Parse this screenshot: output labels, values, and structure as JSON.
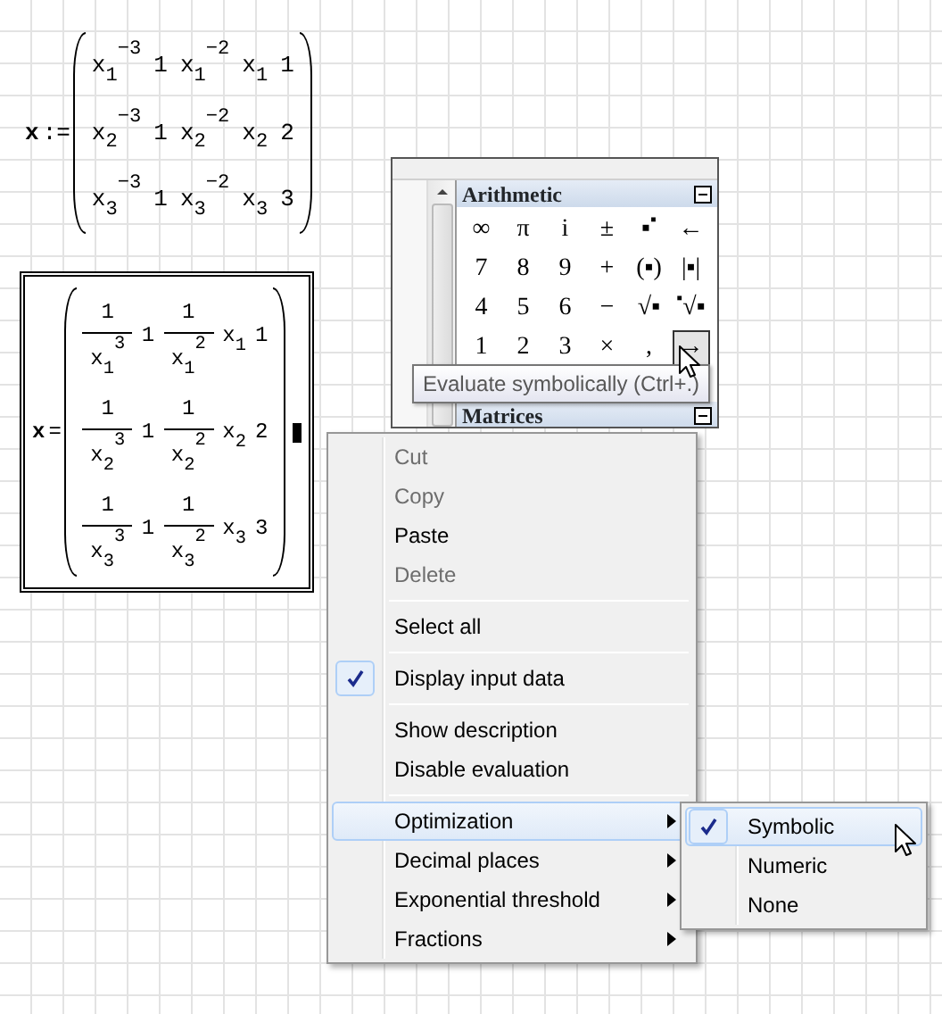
{
  "definition": {
    "variable": "x",
    "operator": ":=",
    "matrix": [
      [
        "x$_{1}$$^{−3}$",
        "1",
        "x$_{1}$$^{−2}$",
        "x$_{1}$",
        "1"
      ],
      [
        "x$_{2}$$^{−3}$",
        "1",
        "x$_{2}$$^{−2}$",
        "x$_{2}$",
        "2"
      ],
      [
        "x$_{3}$$^{−3}$",
        "1",
        "x$_{3}$$^{−2}$",
        "x$_{3}$",
        "3"
      ]
    ]
  },
  "result": {
    "variable": "x",
    "operator": "=",
    "matrix": [
      [
        {
          "kind": "fraction",
          "numerator": "1",
          "denominator": "x$_{1}$$^{3}$"
        },
        {
          "kind": "plain",
          "text": "1"
        },
        {
          "kind": "fraction",
          "numerator": "1",
          "denominator": "x$_{1}$$^{2}$"
        },
        {
          "kind": "plain",
          "text": "x$_{1}$"
        },
        {
          "kind": "plain",
          "text": "1"
        }
      ],
      [
        {
          "kind": "fraction",
          "numerator": "1",
          "denominator": "x$_{2}$$^{3}$"
        },
        {
          "kind": "plain",
          "text": "1"
        },
        {
          "kind": "fraction",
          "numerator": "1",
          "denominator": "x$_{2}$$^{2}$"
        },
        {
          "kind": "plain",
          "text": "x$_{2}$"
        },
        {
          "kind": "plain",
          "text": "2"
        }
      ],
      [
        {
          "kind": "fraction",
          "numerator": "1",
          "denominator": "x$_{3}$$^{3}$"
        },
        {
          "kind": "plain",
          "text": "1"
        },
        {
          "kind": "fraction",
          "numerator": "1",
          "denominator": "x$_{3}$$^{2}$"
        },
        {
          "kind": "plain",
          "text": "x$_{3}$"
        },
        {
          "kind": "plain",
          "text": "3"
        }
      ]
    ]
  },
  "palette": {
    "sections": [
      {
        "title": "Arithmetic",
        "keys": [
          {
            "label": "∞",
            "hovered": false
          },
          {
            "label": "π",
            "hovered": false
          },
          {
            "label": "i",
            "hovered": false
          },
          {
            "label": "±",
            "hovered": false
          },
          {
            "label": "▪$^{▪}$",
            "hovered": false
          },
          {
            "label": "←",
            "hovered": false
          },
          {
            "label": "7",
            "hovered": false
          },
          {
            "label": "8",
            "hovered": false
          },
          {
            "label": "9",
            "hovered": false
          },
          {
            "label": "+",
            "hovered": false
          },
          {
            "label": "(▪)",
            "hovered": false
          },
          {
            "label": "|▪|",
            "hovered": false
          },
          {
            "label": "4",
            "hovered": false
          },
          {
            "label": "5",
            "hovered": false
          },
          {
            "label": "6",
            "hovered": false
          },
          {
            "label": "−",
            "hovered": false
          },
          {
            "label": "√▪",
            "hovered": false
          },
          {
            "label": "$^{▪}$√▪",
            "hovered": false
          },
          {
            "label": "1",
            "hovered": false
          },
          {
            "label": "2",
            "hovered": false
          },
          {
            "label": "3",
            "hovered": false
          },
          {
            "label": "×",
            "hovered": false
          },
          {
            "label": ",",
            "hovered": false
          },
          {
            "label": "→",
            "hovered": true
          }
        ]
      },
      {
        "title": "Matrices"
      }
    ]
  },
  "tooltip": "Evaluate symbolically (Ctrl+.)",
  "context_menu": {
    "groups": [
      {
        "items": [
          {
            "label": "Cut",
            "disabled": true,
            "checked": false,
            "selected": false,
            "submenu": false
          },
          {
            "label": "Copy",
            "disabled": true,
            "checked": false,
            "selected": false,
            "submenu": false
          },
          {
            "label": "Paste",
            "disabled": false,
            "checked": false,
            "selected": false,
            "submenu": false
          },
          {
            "label": "Delete",
            "disabled": true,
            "checked": false,
            "selected": false,
            "submenu": false
          }
        ]
      },
      {
        "items": [
          {
            "label": "Select all",
            "disabled": false,
            "checked": false,
            "selected": false,
            "submenu": false
          }
        ]
      },
      {
        "items": [
          {
            "label": "Display input data",
            "disabled": false,
            "checked": true,
            "selected": false,
            "submenu": false
          }
        ]
      },
      {
        "items": [
          {
            "label": "Show description",
            "disabled": false,
            "checked": false,
            "selected": false,
            "submenu": false
          },
          {
            "label": "Disable evaluation",
            "disabled": false,
            "checked": false,
            "selected": false,
            "submenu": false
          }
        ]
      },
      {
        "items": [
          {
            "label": "Optimization",
            "disabled": false,
            "checked": false,
            "selected": true,
            "submenu": true
          },
          {
            "label": "Decimal places",
            "disabled": false,
            "checked": false,
            "selected": false,
            "submenu": true
          },
          {
            "label": "Exponential threshold",
            "disabled": false,
            "checked": false,
            "selected": false,
            "submenu": true
          },
          {
            "label": "Fractions",
            "disabled": false,
            "checked": false,
            "selected": false,
            "submenu": true
          }
        ]
      }
    ]
  },
  "submenu": {
    "items": [
      {
        "label": "Symbolic",
        "checked": true,
        "selected": true
      },
      {
        "label": "Numeric",
        "checked": false,
        "selected": false
      },
      {
        "label": "None",
        "checked": false,
        "selected": false
      }
    ]
  }
}
